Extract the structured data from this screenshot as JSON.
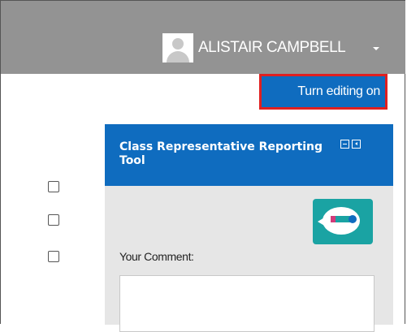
{
  "header": {
    "user_name": "ALISTAIR CAMPBELL",
    "avatar_icon": "user-avatar-icon",
    "caret_icon": "caret-down-icon",
    "background": "#939393"
  },
  "editing": {
    "button_label": "Turn editing on",
    "button_color": "#0f6cbf",
    "highlight_color": "#e02020"
  },
  "checkboxes": [
    {
      "checked": false
    },
    {
      "checked": false
    },
    {
      "checked": false
    }
  ],
  "block": {
    "title": "Class Representative Reporting Tool",
    "header_color": "#0f6cbf",
    "controls": [
      "minimize-icon",
      "dock-icon"
    ],
    "tool_icon": "speech-bubble-pen-icon",
    "comment_label": "Your Comment:",
    "comment_value": ""
  }
}
